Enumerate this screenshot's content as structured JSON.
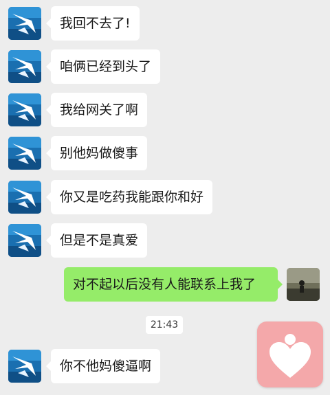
{
  "messages": [
    {
      "side": "in",
      "text": "我回不去了!"
    },
    {
      "side": "in",
      "text": "咱俩已经到头了"
    },
    {
      "side": "in",
      "text": "我给网关了啊"
    },
    {
      "side": "in",
      "text": "别他妈做傻事"
    },
    {
      "side": "in",
      "text": "你又是吃药我能跟你和好"
    },
    {
      "side": "in",
      "text": "但是不是真爱"
    },
    {
      "side": "out",
      "text": "对不起以后没有人能联系上我了"
    },
    {
      "side": "in",
      "text": "你不他妈傻逼啊"
    }
  ],
  "timestamp": "21:43",
  "colors": {
    "background": "#ededed",
    "incoming_bubble": "#ffffff",
    "outgoing_bubble": "#95ec69",
    "overlay_badge": "#f4a8aa"
  },
  "icons": {
    "contact_avatar": "angel-wings-avatar-icon",
    "own_avatar": "photo-avatar-icon",
    "overlay": "heart-person-icon"
  }
}
